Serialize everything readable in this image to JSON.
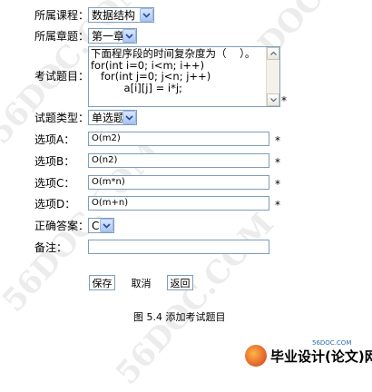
{
  "form": {
    "course": {
      "label": "所属课程：",
      "value": "数据结构"
    },
    "chapter": {
      "label": "所属章题：",
      "value": "第一章"
    },
    "question": {
      "label": "考试题目：",
      "text": "下面程序段的时间复杂度为（    ）。\nfor(int i=0; i<m; i++)\n   for(int j=0; j<n; j++)\n          a[i][j] = i*j;"
    },
    "question_type": {
      "label": "试题类型：",
      "value": "单选题"
    },
    "option_a": {
      "label": "选项A：",
      "value": "O(m2)"
    },
    "option_b": {
      "label": "选项B：",
      "value": "O(n2)"
    },
    "option_c": {
      "label": "选项C：",
      "value": "O(m*n)"
    },
    "option_d": {
      "label": "选项D：",
      "value": "O(m+n)"
    },
    "answer": {
      "label": "正确答案：",
      "value": "C"
    },
    "remark": {
      "label": "备注：",
      "value": ""
    },
    "required_mark": "*"
  },
  "buttons": {
    "save": "保存",
    "cancel": "取消",
    "back": "返回"
  },
  "caption": "图 5.4   添加考试题目",
  "watermark": {
    "text": "56DOC.COM"
  },
  "footer": {
    "logo_text": "毕业设计(论文)网",
    "site": "56DOC.COM"
  },
  "colors": {
    "border": "#7f9db9",
    "dropdown_button": "#a9c6f5",
    "watermark": "#ececec",
    "logo_site": "#2a6bb3"
  },
  "icons": {
    "dropdown": "chevron-down-icon",
    "scroll_up": "arrow-up-icon",
    "scroll_down": "arrow-down-icon"
  }
}
